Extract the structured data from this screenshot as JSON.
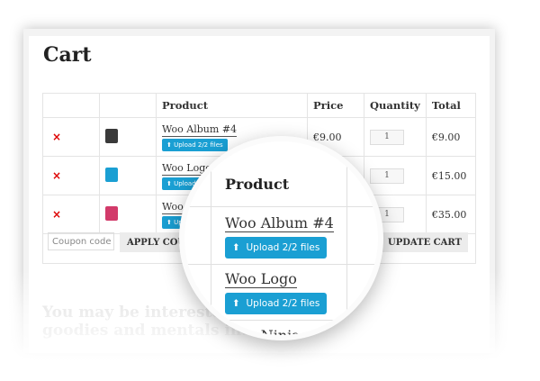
{
  "cart": {
    "title": "Cart",
    "columns": [
      "",
      "",
      "Product",
      "Price",
      "Quantity",
      "Total"
    ],
    "remove_symbol": "×",
    "upload_icon": "⬆",
    "items": [
      {
        "name": "Woo Album #4",
        "upload": "Upload 2/2 files",
        "price": "€9.00",
        "qty": "1",
        "total": "€9.00",
        "thumb_color": "#3a3a3a"
      },
      {
        "name": "Woo Logo",
        "upload": "Upload 2/2 files",
        "price": "",
        "qty": "1",
        "total": "€15.00",
        "thumb_color": "#1a9fd3"
      },
      {
        "name": "Woo N",
        "upload": "Upl",
        "price": "",
        "qty": "1",
        "total": "€35.00",
        "thumb_color": "#d23a6a"
      }
    ],
    "coupon_placeholder": "Coupon code",
    "apply_label": "APPLY COUPON",
    "update_label": "UPDATE CART"
  },
  "interested": "You may be interested in these goodies and mentals in...",
  "magnifier": {
    "header": "Product",
    "item1_name": "Woo Album #4",
    "item1_upload": "Upload 2/2 files",
    "item2_name": "Woo Logo",
    "item2_upload": "Upload 2/2 files",
    "item3_name": "Woo Ninja"
  },
  "colors": {
    "accent": "#1a9fd3",
    "remove": "#dd0000"
  }
}
